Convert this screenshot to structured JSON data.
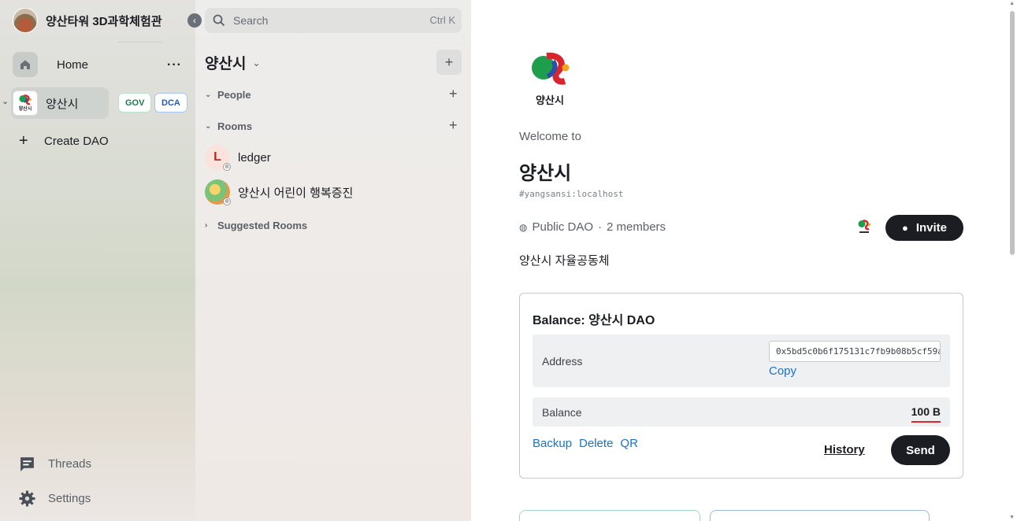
{
  "profile": {
    "name": "양산타워 3D과학체험관"
  },
  "sidebar": {
    "home_label": "Home",
    "more_label": "···",
    "space": {
      "name": "양산시",
      "badges": [
        "GOV",
        "DCA"
      ]
    },
    "create_label": "Create DAO",
    "threads_label": "Threads",
    "settings_label": "Settings"
  },
  "room_panel": {
    "search_placeholder": "Search",
    "search_shortcut": "Ctrl K",
    "space_title": "양산시",
    "sections": {
      "people": "People",
      "rooms": "Rooms",
      "suggested": "Suggested Rooms"
    },
    "rooms": [
      {
        "name": "ledger",
        "initial": "L"
      },
      {
        "name": "양산시 어린이 행복증진"
      }
    ]
  },
  "main": {
    "logo_text": "양산시",
    "welcome": "Welcome to",
    "title": "양산시",
    "alias": "#yangsansi:localhost",
    "visibility": "Public DAO",
    "members": "2 members",
    "invite_label": "Invite",
    "description": "양산시 자율공동체",
    "balance_card": {
      "title": "Balance: 양산시 DAO",
      "address_label": "Address",
      "address_value": "0x5bd5c0b6f175131c7fb9b08b5cf59a…",
      "copy_label": "Copy",
      "balance_label": "Balance",
      "balance_value": "100 B",
      "actions": [
        "Backup",
        "Delete",
        "QR"
      ],
      "history_label": "History",
      "send_label": "Send"
    }
  },
  "colors": {
    "accent": "#1a73c9",
    "dark_button": "#1b1d22",
    "underline": "#e0242b"
  }
}
